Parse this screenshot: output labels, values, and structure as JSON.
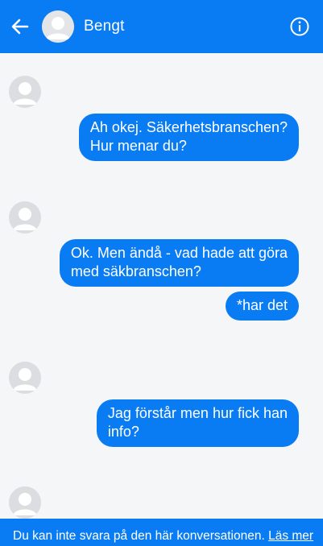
{
  "header": {
    "contact_name": "Bengt",
    "back_icon": "arrow-left-icon",
    "info_icon": "info-icon",
    "background": "#0a7cf3"
  },
  "messages": [
    {
      "sender": "me",
      "text": "Ah okej. Säkerhetsbranschen?\nHur menar du?"
    },
    {
      "sender": "me",
      "text": "Ok. Men ändå - vad hade att göra\nmed säkbranschen?"
    },
    {
      "sender": "me",
      "text": "*har det"
    },
    {
      "sender": "me",
      "text": "Jag förstår men hur fick han\ninfo?"
    }
  ],
  "footer": {
    "notice": "Du kan inte svara på den här konversationen. ",
    "link": "Läs mer"
  }
}
